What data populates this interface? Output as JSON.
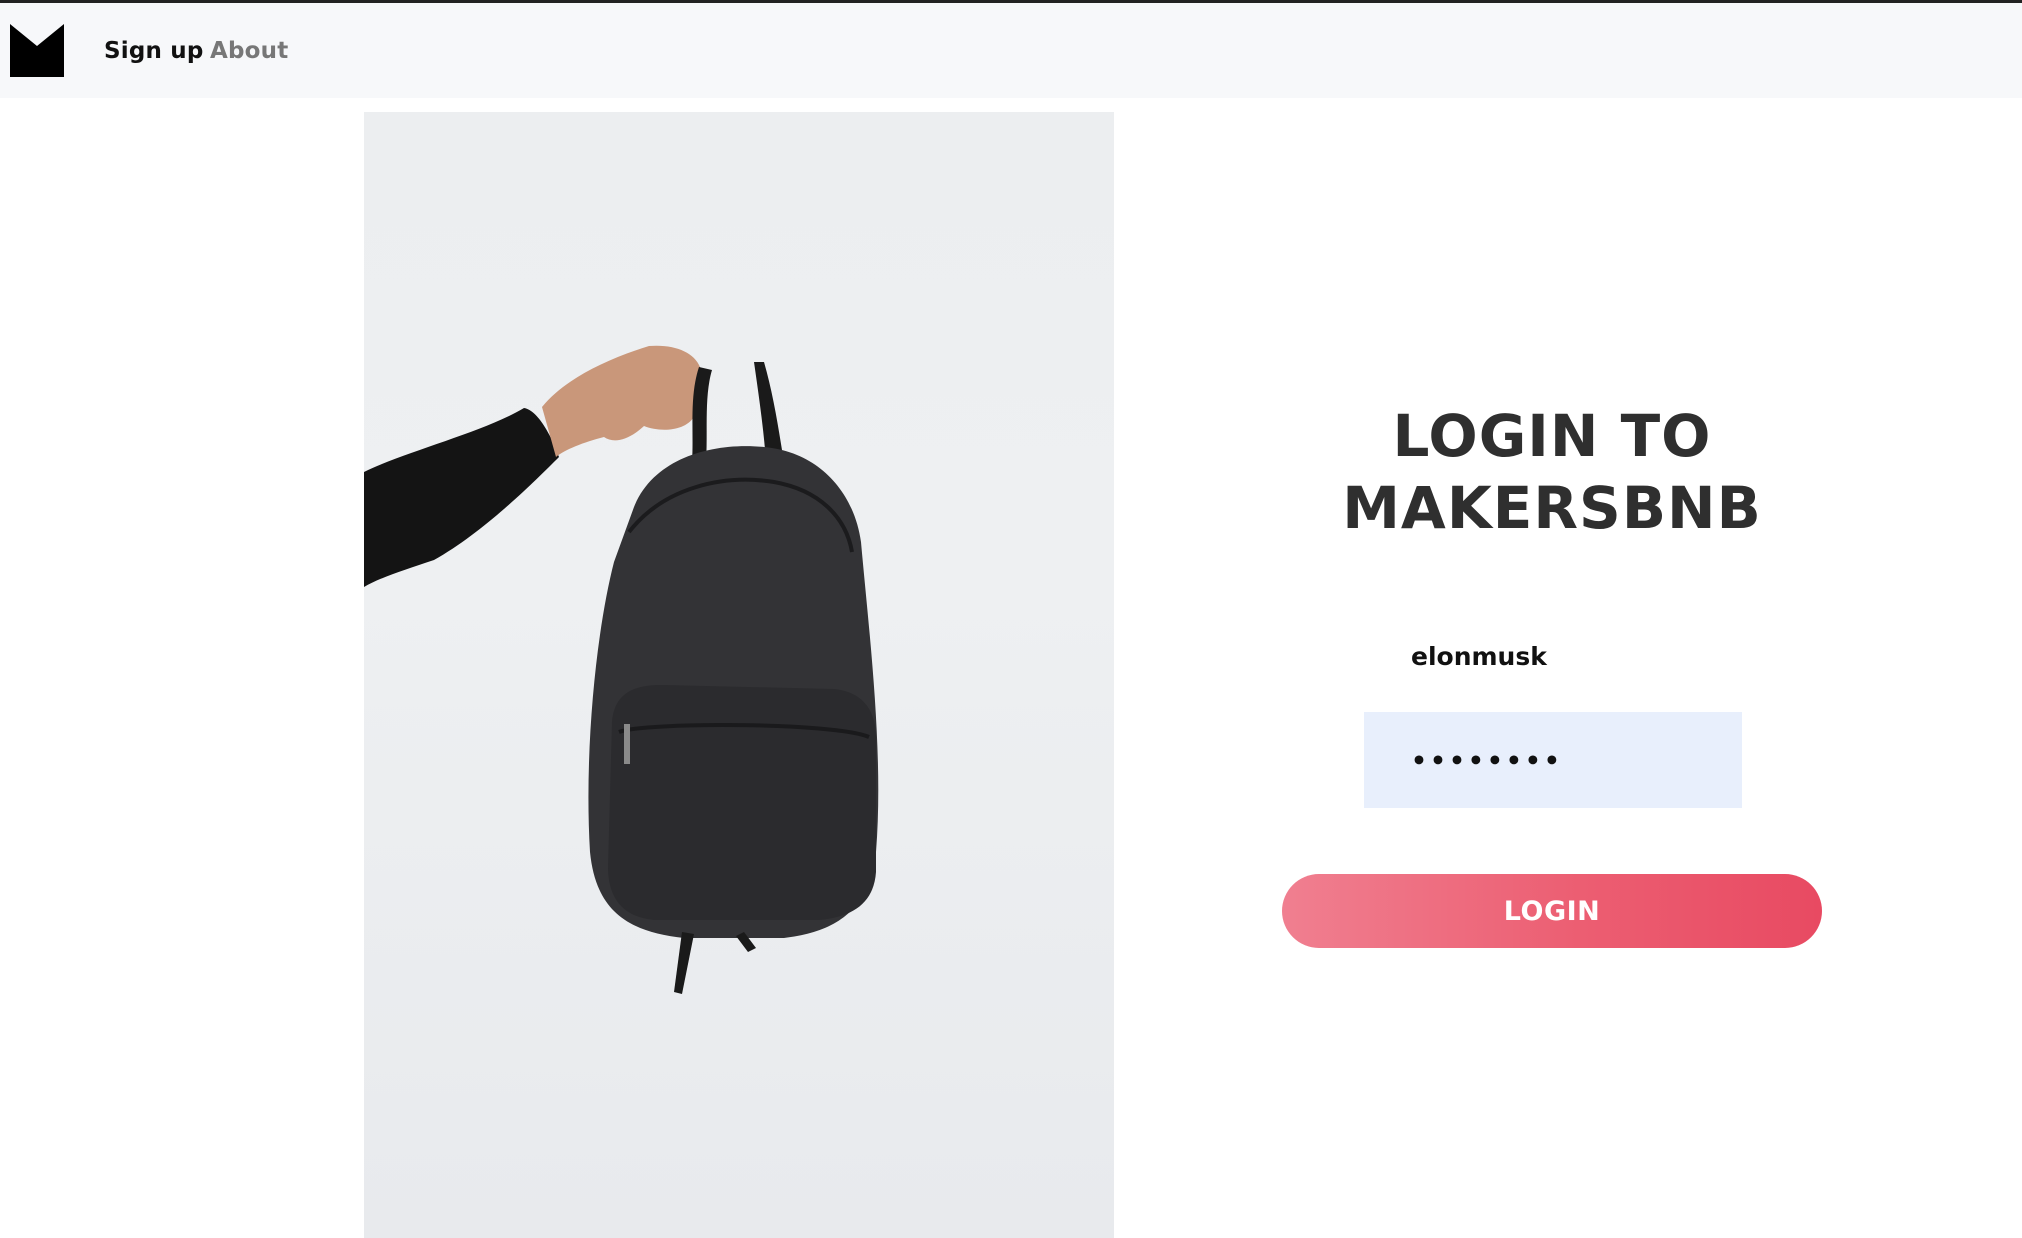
{
  "nav": {
    "logo_name": "m-logo-icon",
    "links": [
      {
        "label": "Sign up"
      },
      {
        "label": "About"
      }
    ]
  },
  "hero": {
    "image_name": "backpack-photo"
  },
  "login": {
    "title_line1": "LOGIN TO",
    "title_line2": "MAKERSBNB",
    "username_value": "elonmusk",
    "password_value": "••••••••",
    "button_label": "LOGIN"
  },
  "colors": {
    "button_gradient_start": "#f07f90",
    "button_gradient_end": "#e84a62",
    "password_field_bg": "#e8effc",
    "title_color": "#2f2f2f"
  }
}
